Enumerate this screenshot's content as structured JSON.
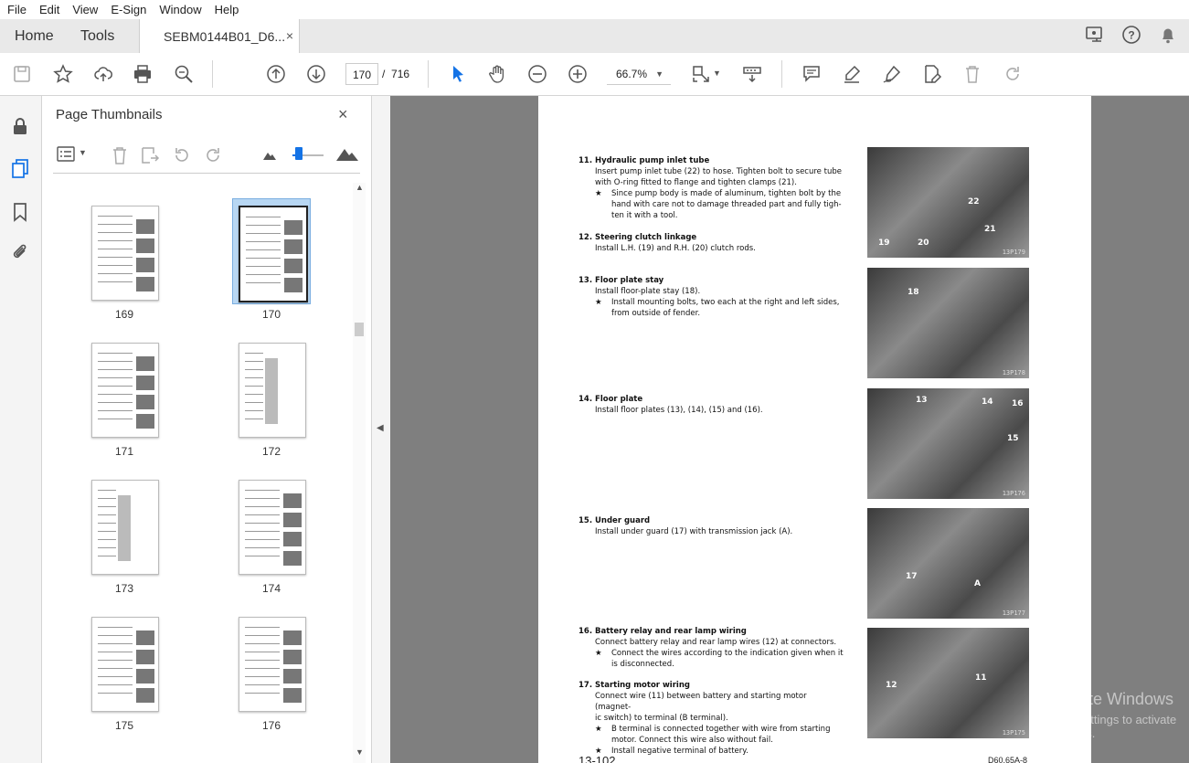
{
  "menu": [
    "File",
    "Edit",
    "View",
    "E-Sign",
    "Window",
    "Help"
  ],
  "tabs": {
    "home": "Home",
    "tools": "Tools",
    "doc": "SEBM0144B01_D6...",
    "doc_close": "×"
  },
  "toolbar": {
    "page_current": "170",
    "page_sep": "/",
    "page_total": "716",
    "zoom": "66.7%"
  },
  "panel": {
    "title": "Page Thumbnails",
    "close": "×"
  },
  "thumbnails": [
    "169",
    "170",
    "171",
    "172",
    "173",
    "174",
    "175",
    "176"
  ],
  "selected_thumbnail": "170",
  "document": {
    "steps": [
      {
        "title": "11.  Hydraulic pump inlet tube",
        "lines": [
          "Insert pump inlet tube (22) to hose. Tighten bolt to secure tube",
          "with O-ring fitted to flange and tighten clamps (21)."
        ],
        "notes": [
          [
            "Since pump body is made of aluminum, tighten bolt by the",
            "hand with care not to damage threaded part and fully tigh-",
            "ten it with a tool."
          ]
        ]
      },
      {
        "title": "12.  Steering clutch linkage",
        "lines": [
          "Install L.H. (19) and R.H. (20) clutch rods."
        ],
        "notes": []
      },
      {
        "title": "13.  Floor plate stay",
        "lines": [
          "Install floor-plate stay (18)."
        ],
        "notes": [
          [
            "Install mounting bolts, two each at the right and left sides,",
            "from outside of fender."
          ]
        ]
      },
      {
        "title": "14.  Floor plate",
        "lines": [
          "Install floor plates (13), (14), (15) and (16)."
        ],
        "notes": []
      },
      {
        "title": "15.  Under guard",
        "lines": [
          "Install under guard (17) with transmission jack (A)."
        ],
        "notes": []
      },
      {
        "title": "16.  Battery relay and rear lamp wiring",
        "lines": [
          "Connect battery relay and rear lamp wires (12) at connectors."
        ],
        "notes": [
          [
            "Connect the wires according to the indication given when it",
            "is disconnected."
          ]
        ]
      },
      {
        "title": "17.  Starting motor wiring",
        "lines": [
          "Connect wire (11) between battery and starting motor (magnet-",
          "ic switch) to terminal (B terminal)."
        ],
        "notes": [
          [
            "B terminal is connected together with wire from starting",
            "motor. Connect this wire also without fail."
          ],
          [
            "Install negative terminal of battery."
          ]
        ]
      }
    ],
    "star": "★",
    "photos": [
      {
        "caption": "13P179",
        "labels": [
          "22",
          "21",
          "19",
          "20"
        ]
      },
      {
        "caption": "13P178",
        "labels": [
          "18"
        ]
      },
      {
        "caption": "13P176",
        "labels": [
          "13",
          "14",
          "16",
          "15"
        ]
      },
      {
        "caption": "13P177",
        "labels": [
          "17",
          "A"
        ]
      },
      {
        "caption": "13P175",
        "labels": [
          "12",
          "11"
        ]
      }
    ],
    "page_number": "13-102",
    "model": "D60,65A-8"
  },
  "watermark": {
    "line1": "Activate Windows",
    "line2": "Go to Settings to activate Windows."
  },
  "colors": {
    "accent": "#1473e6",
    "tabbar": "#e9e9e9",
    "viewer_bg": "#7f7f7f"
  }
}
